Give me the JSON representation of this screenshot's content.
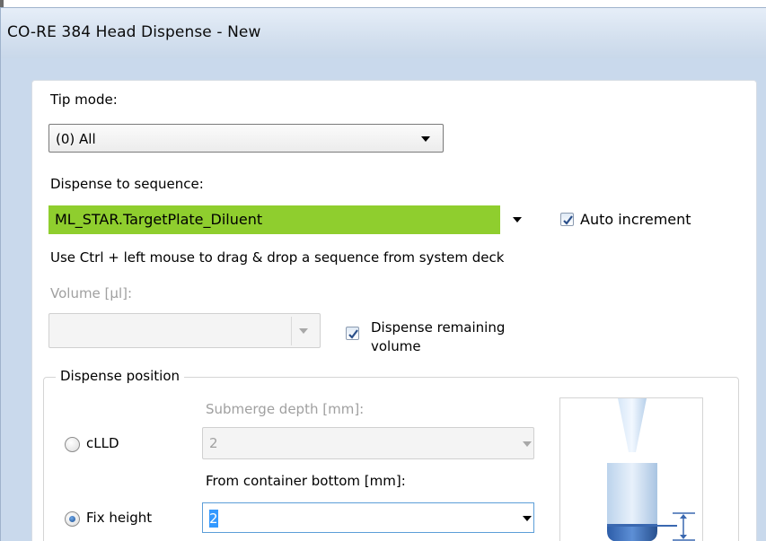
{
  "window": {
    "title": "CO-RE 384 Head Dispense - New"
  },
  "tip_mode": {
    "label": "Tip mode:",
    "value": "(0) All"
  },
  "sequence": {
    "label": "Dispense to sequence:",
    "value": "ML_STAR.TargetPlate_Diluent",
    "auto_increment_label": "Auto increment",
    "auto_increment_checked": true,
    "hint": "Use Ctrl + left mouse to drag & drop a sequence from system deck",
    "highlight_color": "#8fce2e"
  },
  "volume": {
    "label": "Volume [µl]:",
    "value": "",
    "dispense_remaining_label_line1": "Dispense remaining",
    "dispense_remaining_label_line2": "volume",
    "dispense_remaining_checked": true
  },
  "dispense_position": {
    "group_title": "Dispense position",
    "clld_label": "cLLD",
    "submerge_label": "Submerge depth [mm]:",
    "submerge_value": "2",
    "fix_height_label": "Fix height",
    "from_bottom_label": "From container bottom [mm]:",
    "from_bottom_value": "2",
    "selected_mode": "Fix height"
  },
  "icons": {
    "dropdown": "chevron-down-icon",
    "checkbox": "checkmark-icon",
    "preview": "tip-container-illustration"
  }
}
